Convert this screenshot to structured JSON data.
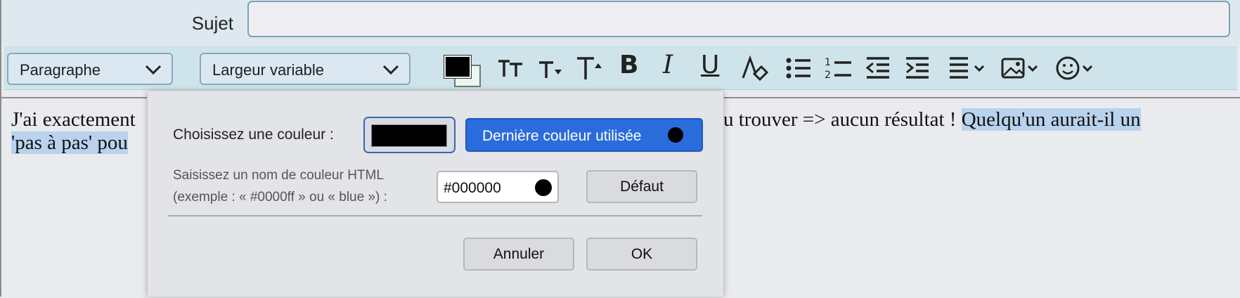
{
  "header": {
    "subject_label": "Sujet",
    "subject_value": ""
  },
  "toolbar": {
    "paragraph_format": "Paragraphe",
    "font_family": "Largeur variable",
    "text_color": "#000000",
    "background_color": "#eaf6ef",
    "icons": [
      "smaller-text-icon",
      "decrease-size-icon",
      "increase-size-icon",
      "bold-icon",
      "italic-icon",
      "underline-icon",
      "clear-formatting-icon",
      "bullet-list-icon",
      "numbered-list-icon",
      "outdent-icon",
      "indent-icon",
      "align-menu-icon",
      "insert-image-menu-icon",
      "emoji-menu-icon"
    ],
    "bold_label": "B",
    "italic_label": "I",
    "underline_label": "U"
  },
  "editor": {
    "line1_start": "J'ai exactement",
    "line1_end": "u trouver => aucun résultat ! ",
    "line1_highlight": "Quelqu'un aurait-il un",
    "line2_highlight": "'pas à pas' pou"
  },
  "dialog": {
    "choose_label": "Choisissez une couleur :",
    "current_color": "#000000",
    "last_used_label": "Dernière couleur utilisée",
    "html_hint_line1": "Saisissez un nom de couleur HTML",
    "html_hint_line2": "(exemple : « #0000ff » ou « blue ») :",
    "hex_value": "#000000",
    "default_button": "Défaut",
    "cancel_button": "Annuler",
    "ok_button": "OK"
  },
  "colors": {
    "accent": "#2a6cdc",
    "toolbar_bg": "#cfe4ea",
    "highlight": "#b9d2ee"
  }
}
